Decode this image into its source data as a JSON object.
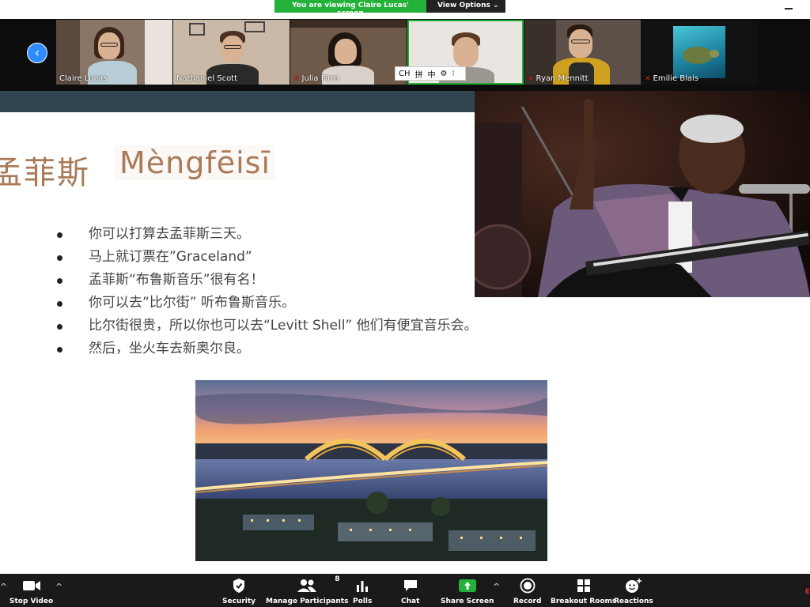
{
  "banner": {
    "viewing": "You are viewing Claire Lucas' screen",
    "view_options": "View Options ⌄"
  },
  "participants": [
    {
      "name": "Claire Lucas",
      "muted": false
    },
    {
      "name": "Nathaniel Scott",
      "muted": false
    },
    {
      "name": "Julia Pirro",
      "muted": true
    },
    {
      "name": "",
      "muted": false
    },
    {
      "name": "Ryan Mennitt",
      "muted": true
    },
    {
      "name": "Emilie Blais",
      "muted": true
    }
  ],
  "ime": {
    "lang": "CH",
    "grid": "拼",
    "mode": "中",
    "settings": "⚙",
    "more": "⁝"
  },
  "slide": {
    "title_cn": "孟菲斯",
    "title_pinyin": "Mèngfēisī",
    "bullets": [
      "你可以打算去孟菲斯三天。",
      "马上就订票在”Graceland”",
      "孟菲斯“布鲁斯音乐”很有名！",
      "你可以去”比尔街” 听布鲁斯音乐。",
      "比尔街很贵，所以你也可以去“Levitt Shell” 他们有便宜音乐会。",
      "然后，坐火车去新奥尔良。"
    ]
  },
  "toolbar": {
    "stop_video": "Stop Video",
    "security": "Security",
    "manage_participants": "Manage Participants",
    "participant_count": "8",
    "polls": "Polls",
    "chat": "Chat",
    "share_screen": "Share Screen",
    "record": "Record",
    "breakout_rooms": "Breakout Rooms",
    "reactions": "Reactions",
    "end": "E"
  },
  "colors": {
    "accent_green": "#23b13a",
    "accent_blue": "#2d8cff",
    "slide_band": "#304550",
    "title_brown": "#a97a58",
    "end_red": "#e02828"
  }
}
